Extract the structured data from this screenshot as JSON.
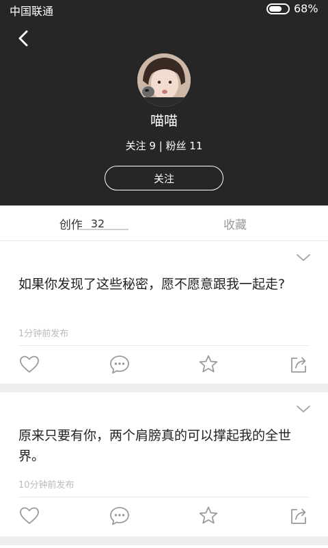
{
  "status_bar": {
    "carrier": "中国联通",
    "battery": "68%",
    "battery_level": 0.68
  },
  "profile": {
    "name": "喵喵",
    "stats": "关注 9 | 粉丝 11",
    "follow_label": "关注"
  },
  "tabs": {
    "create_label": "创作",
    "create_count": "32",
    "favorites_label": "收藏"
  },
  "posts": [
    {
      "text": "如果你发现了这些秘密，愿不愿意跟我一起走?",
      "time": "1分钟前发布"
    },
    {
      "text": "原来只要有你，两个肩膀真的可以撑起我的全世界。",
      "time": "10分钟前发布"
    }
  ],
  "icons": [
    "back-arrow-icon",
    "chevron-down-icon",
    "heart-icon",
    "comment-icon",
    "star-icon",
    "share-icon"
  ],
  "colors": {
    "header_bg": "#262626",
    "icon_gray": "#9a9a9a",
    "page_bg": "#eeeeee"
  }
}
